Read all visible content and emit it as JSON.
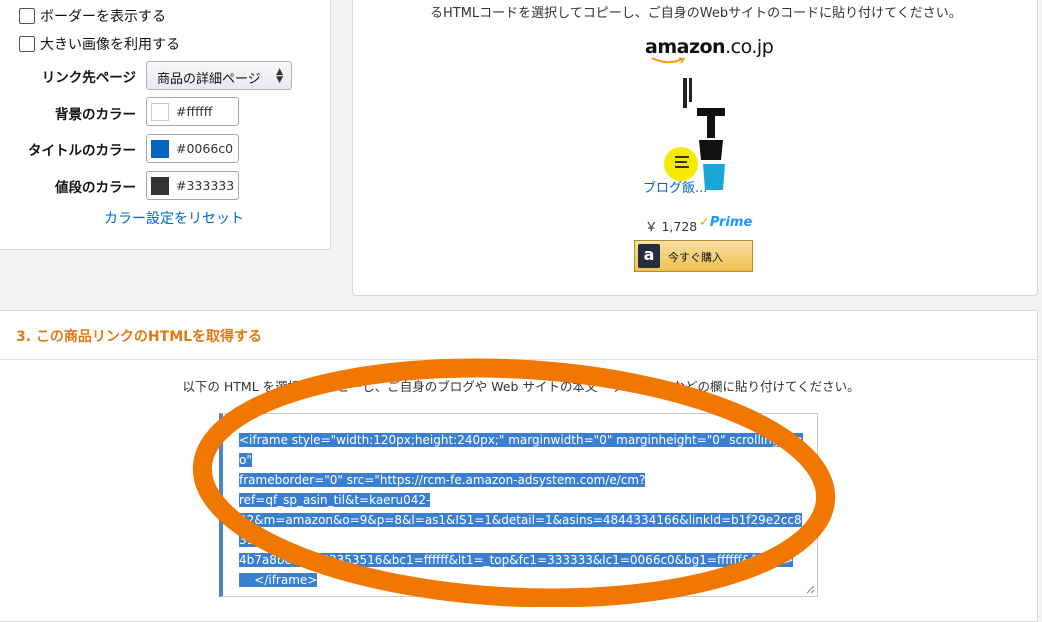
{
  "settings": {
    "border_checkbox_label": "ボーダーを表示する",
    "large_image_checkbox_label": "大きい画像を利用する",
    "link_dest_label": "リンク先ページ",
    "link_dest_value": "商品の詳細ページ",
    "bg_color_label": "背景のカラー",
    "bg_color_value": "#ffffff",
    "title_color_label": "タイトルのカラー",
    "title_color_value": "#0066c0",
    "price_color_label": "値段のカラー",
    "price_color_value": "#333333",
    "reset_link": "カラー設定をリセット"
  },
  "preview": {
    "instruction": "るHTMLコードを選択してコピーし、ご自身のWebサイトのコードに貼り付けてください。",
    "logo_text": "amazon",
    "logo_suffix": ".co.jp",
    "product_title": "ブログ飯...",
    "price": "￥ 1,728",
    "prime_label": "Prime",
    "buy_button": "今すぐ購入",
    "buy_icon_letter": "a"
  },
  "section3": {
    "title": "3. この商品リンクのHTMLを取得する",
    "instruction": "以下の HTML を選択してコピーし、ご自身のブログや Web サイトの本文・サイドバーなどの欄に貼り付けてください。",
    "code_lines": [
      "<iframe style=\"width:120px;height:240px;\" marginwidth=\"0\" marginheight=\"0\" scrolling=\"no\"",
      "frameborder=\"0\" src=\"https://rcm-fe.amazon-adsystem.com/e/cm?",
      "ref=qf_sp_asin_til&t=kaeru042-",
      "22&m=amazon&o=9&p=8&l=as1&IS1=1&detail=1&asins=4844334166&linkId=b1f29e2cc8391",
      "4b7a8bce4d143353516&bc1=ffffff&lt1=_top&fc1=333333&lc1=0066c0&bg1=ffffff&f=ifr\">",
      "    </iframe>"
    ]
  },
  "colors": {
    "annotation": "#f07800",
    "link_blue": "#0066c0",
    "section_title_orange": "#e47911",
    "selection_blue": "#3b80d0"
  }
}
